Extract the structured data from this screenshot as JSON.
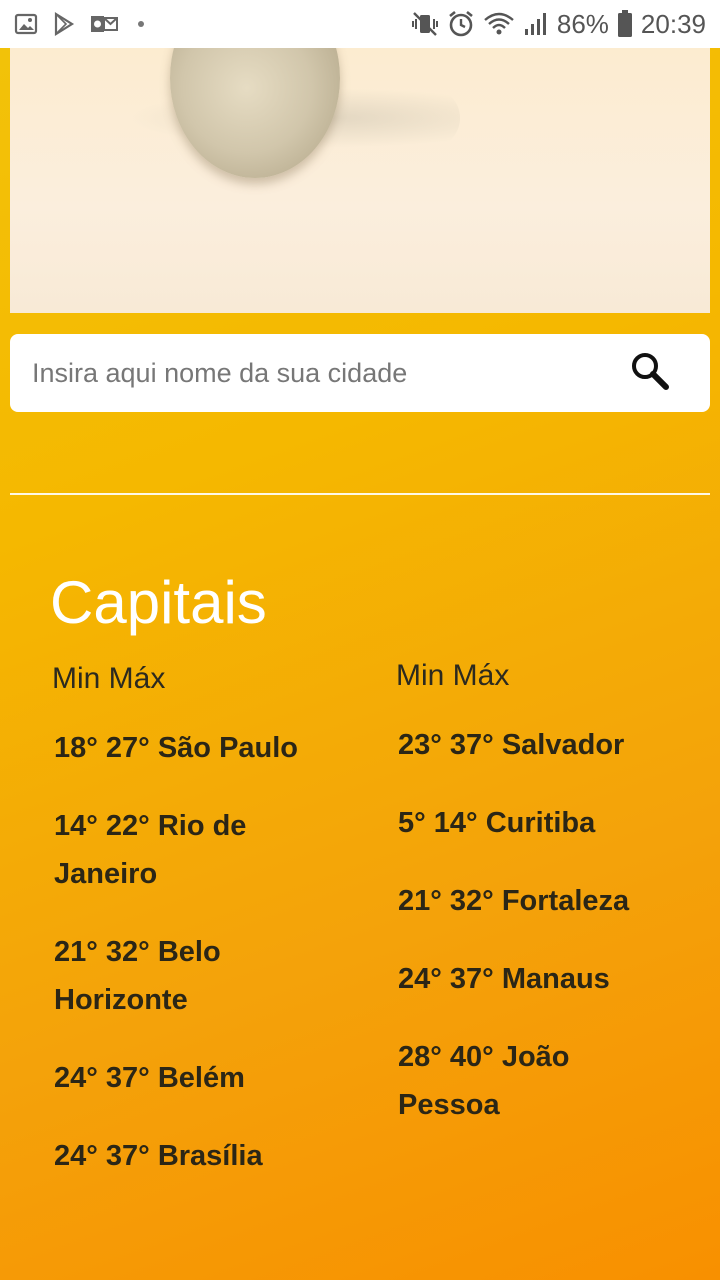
{
  "status_bar": {
    "battery_percent": "86%",
    "time": "20:39",
    "icons_left": [
      "gallery-icon",
      "play-store-icon",
      "outlook-icon",
      "notification-dot"
    ],
    "icons_right": [
      "mute-vibrate-icon",
      "alarm-icon",
      "wifi-icon",
      "signal-icon",
      "battery-icon"
    ]
  },
  "search": {
    "placeholder": "Insira aqui nome da sua cidade",
    "value": ""
  },
  "capitals": {
    "title": "Capitais",
    "left_column": {
      "header": "Min Máx",
      "items": [
        "18° 27° São Paulo",
        "14° 22° Rio de Janeiro",
        "21° 32° Belo Horizonte",
        "24° 37° Belém",
        "24° 37° Brasília"
      ]
    },
    "right_column": {
      "header": "Min Máx",
      "items": [
        "23° 37° Salvador",
        "5° 14° Curitiba",
        "21° 32° Fortaleza",
        "24° 37° Manaus",
        "28° 40° João Pessoa"
      ]
    }
  },
  "colors": {
    "gradient_start": "#f2c30a",
    "gradient_end": "#f89000",
    "title": "#ffffff",
    "text": "#2b2616"
  }
}
